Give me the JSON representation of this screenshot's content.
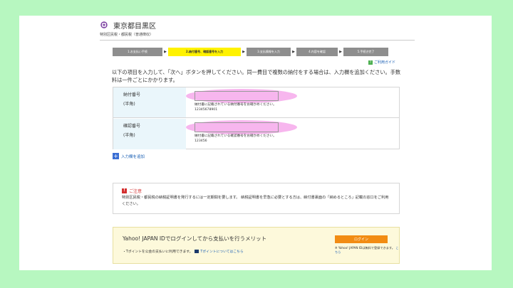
{
  "header": {
    "city_name": "東京都目黒区",
    "tax_type": "特別区民税・都民税（普通徴収）"
  },
  "steps": [
    {
      "label": "1.お支払い手続",
      "active": false
    },
    {
      "label": "2.納付番号、確認番号を入力",
      "active": true
    },
    {
      "label": "3.支払情報を入力",
      "active": false
    },
    {
      "label": "4.内容を確認",
      "active": false
    },
    {
      "label": "5.手続き完了",
      "active": false
    }
  ],
  "guide_label": "ご利用ガイド",
  "intro_text": "以下の項目を入力して、「次へ」ボタンを押してください。同一費目で複数の納付をする場合は、入力欄を追加ください。手数料は一件ごとにかかります。",
  "form": {
    "payment_number": {
      "label": "納付番号",
      "note": "(半角)",
      "value": "",
      "help": "納付書に記載されている納付番号をお確かめください。",
      "example": "12345678901"
    },
    "confirmation_number": {
      "label": "確認番号",
      "note": "(半角)",
      "value": "",
      "help": "納付書に記載されている確認番号をお確かめください。",
      "example": "123456"
    }
  },
  "add_field_label": "入力欄を追加",
  "notice": {
    "title": "ご注意",
    "body": "特別区民税・都民税の納税証明書を発行するには一定期間を要します。 納税証明書を早急に必要とする方は、納付書裏面の「納めるところ」記載の窓口をご利用ください。"
  },
  "yahoo": {
    "title": "Yahoo! JAPAN IDでログインしてから支払いを行うメリット",
    "note": "・Tポイントを公金の支払いに利用できます。",
    "tpoint_link": "Tポイントについてはこちら",
    "login_button": "ログイン",
    "login_note": "※ Yahoo! JAPAN IDは無料で登録できます。",
    "login_link": "こちら"
  },
  "colors": {
    "background": "#b7f7c0",
    "active_step": "#fff200",
    "inactive_step": "#8e8e8e",
    "highlight": "#f7b6ee",
    "login_button": "#f28c13"
  }
}
